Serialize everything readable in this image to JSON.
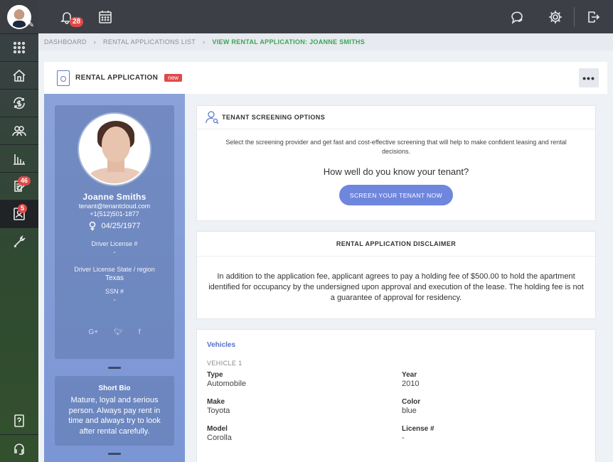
{
  "sidebar": {
    "badges": {
      "applications": "46",
      "tenants": "5"
    }
  },
  "topbar": {
    "notifications_count": "28"
  },
  "breadcrumb": {
    "items": [
      "DASHBOARD",
      "RENTAL APPLICATIONS LIST"
    ],
    "current": "VIEW RENTAL APPLICATION: JOANNE SMITHS"
  },
  "header": {
    "title": "RENTAL APPLICATION",
    "badge": "new",
    "more": "•••"
  },
  "profile": {
    "name": "Joanne Smiths",
    "email": "tenant@tenantcloud.com",
    "phone": "+1(512)501-1877",
    "dob": "04/25/1977",
    "fields": [
      {
        "label": "Driver License #",
        "value": "-"
      },
      {
        "label": "Driver License State / region",
        "value": "Texas"
      },
      {
        "label": "SSN #",
        "value": "-"
      }
    ],
    "social": [
      "G+",
      "twitter",
      "f"
    ]
  },
  "bio": {
    "title": "Short Bio",
    "text": "Mature, loyal and serious person. Always pay rent in time and always try to look after rental carefully."
  },
  "screening": {
    "title": "TENANT SCREENING OPTIONS",
    "description": "Select the screening provider and get fast and cost-effective screening that will help to make confident leasing and rental decisions.",
    "question": "How well do you know your tenant?",
    "button": "SCREEN YOUR TENANT NOW"
  },
  "disclaimer": {
    "title": "RENTAL APPLICATION DISCLAIMER",
    "text": "In addition to the application fee, applicant agrees to pay a holding fee of $500.00 to hold the apartment identified for occupancy by the undersigned upon approval and execution of the lease. The holding fee is not a guarantee of approval for residency."
  },
  "vehicles": {
    "title": "Vehicles",
    "vehicle_label": "VEHICLE 1",
    "fields": [
      {
        "label": "Type",
        "value": "Automobile"
      },
      {
        "label": "Year",
        "value": "2010"
      },
      {
        "label": "Make",
        "value": "Toyota"
      },
      {
        "label": "Color",
        "value": "blue"
      },
      {
        "label": "Model",
        "value": "Corolla"
      },
      {
        "label": "License #",
        "value": "-"
      }
    ]
  }
}
